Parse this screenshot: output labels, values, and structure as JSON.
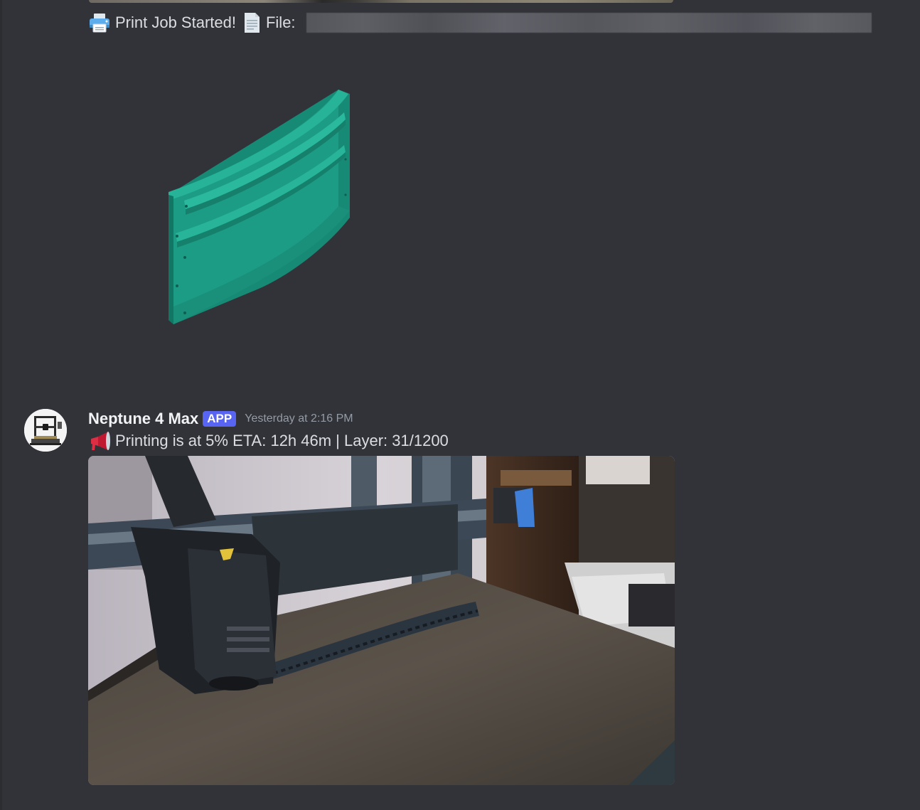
{
  "messages": [
    {
      "text_prefix": "Print Job Started!",
      "file_label": "File:",
      "emoji_1": "printer-icon",
      "emoji_2": "page-document-icon",
      "attachment": "3d-part-preview"
    },
    {
      "author": "Neptune 4 Max",
      "badge": "APP",
      "timestamp": "Yesterday at 2:16 PM",
      "emoji": "loudspeaker-icon",
      "text": "Printing is at 5% ETA: 12h 46m | Layer: 31/1200",
      "attachment": "printer-camera-snapshot"
    }
  ],
  "progress": {
    "percent": 5,
    "layer_current": 31,
    "layer_total": 1200
  },
  "colors": {
    "background": "#323339",
    "badge": "#5865f2",
    "part": "#1f9c86"
  }
}
